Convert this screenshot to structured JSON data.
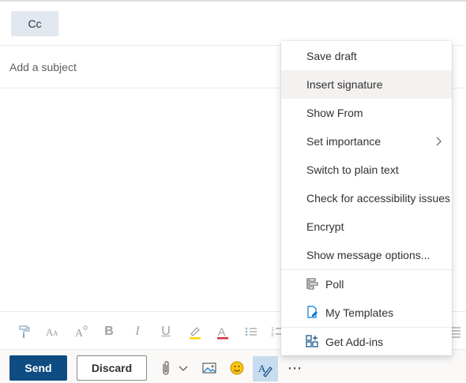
{
  "compose": {
    "cc_label": "Cc",
    "subject_placeholder": "Add a subject"
  },
  "actions": {
    "send_label": "Send",
    "discard_label": "Discard",
    "more_label": "⋯"
  },
  "format_toolbar": {
    "font_size_glyph": "A",
    "bold_glyph": "B",
    "italic_glyph": "I",
    "underline_glyph": "U",
    "font_color_glyph": "A"
  },
  "more_menu": {
    "items": [
      {
        "label": "Save draft"
      },
      {
        "label": "Insert signature"
      },
      {
        "label": "Show From"
      },
      {
        "label": "Set importance"
      },
      {
        "label": "Switch to plain text"
      },
      {
        "label": "Check for accessibility issues"
      },
      {
        "label": "Encrypt"
      },
      {
        "label": "Show message options..."
      }
    ],
    "addin_items": [
      {
        "label": "Poll"
      },
      {
        "label": "My Templates"
      }
    ],
    "get_addins_label": "Get Add-ins"
  },
  "colors": {
    "send_button": "#0f4c81",
    "accent": "#0078d4",
    "highlight_yellow": "#ffd700",
    "font_color_red": "#d13438"
  }
}
